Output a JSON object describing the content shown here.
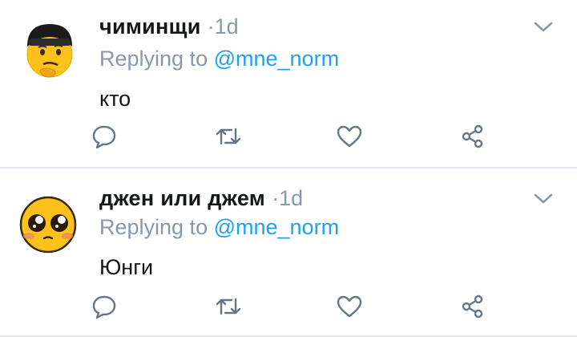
{
  "colors": {
    "name": "#14171a",
    "muted": "#8899a6",
    "link": "#1da1f2",
    "divider": "#e1e8ed",
    "avatar_yellow": "#fcc21b"
  },
  "tweets": [
    {
      "display_name": "чиминщи",
      "separator": "·",
      "time": "1d",
      "replying_prefix": "Replying to ",
      "replying_handle": "@mne_norm",
      "text": "кто",
      "avatar_icon": "thinking-cap-emoji-avatar"
    },
    {
      "display_name": "джен или джем",
      "separator": "·",
      "time": "1d",
      "replying_prefix": "Replying to ",
      "replying_handle": "@mne_norm",
      "text": "Юнги",
      "avatar_icon": "pleading-face-emoji-avatar"
    }
  ],
  "action_icons": [
    "reply-icon",
    "retweet-icon",
    "like-icon",
    "share-icon"
  ]
}
